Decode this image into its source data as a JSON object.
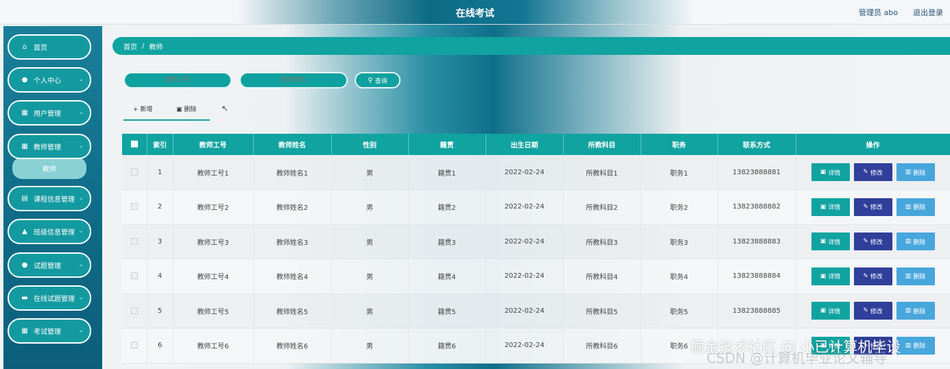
{
  "header": {
    "title": "在线考试",
    "admin_label": "管理员 abo",
    "logout_label": "退出登录"
  },
  "sidebar": {
    "items": [
      {
        "label": "首页",
        "icon": "home-icon",
        "glyph": "⌂",
        "has_chevron": false
      },
      {
        "label": "个人中心",
        "icon": "user-icon",
        "glyph": "●",
        "has_chevron": true
      },
      {
        "label": "用户管理",
        "icon": "grid-icon",
        "glyph": "▦",
        "has_chevron": true
      },
      {
        "label": "教师管理",
        "icon": "grid-icon",
        "glyph": "▦",
        "has_chevron": true
      },
      {
        "label": "课程信息管理",
        "icon": "document-icon",
        "glyph": "▤",
        "has_chevron": true
      },
      {
        "label": "班级信息管理",
        "icon": "thumbs-up-icon",
        "glyph": "▲",
        "has_chevron": true
      },
      {
        "label": "试题管理",
        "icon": "bulb-icon",
        "glyph": "●",
        "has_chevron": true
      },
      {
        "label": "在线试题管理",
        "icon": "card-icon",
        "glyph": "▬",
        "has_chevron": true
      },
      {
        "label": "考试管理",
        "icon": "grid-icon",
        "glyph": "▦",
        "has_chevron": true
      }
    ],
    "submenu_active": "教师"
  },
  "breadcrumb": {
    "home": "首页",
    "separator": "/",
    "current": "教师"
  },
  "search": {
    "teacher_id_placeholder": "教师工号",
    "teacher_name_placeholder": "教师姓名",
    "button_label": "查询"
  },
  "actions": {
    "add_label": "新增",
    "delete_label": "删除"
  },
  "table": {
    "columns": [
      "索引",
      "教师工号",
      "教师姓名",
      "性别",
      "籍贯",
      "出生日期",
      "所教科目",
      "职务",
      "联系方式",
      "操作"
    ],
    "rows": [
      {
        "index": "1",
        "teacher_id": "教师工号1",
        "name": "教师姓名1",
        "gender": "男",
        "hometown": "籍贯1",
        "birth": "2022-02-24",
        "subject": "所教科目1",
        "position": "职务1",
        "phone": "13823888881"
      },
      {
        "index": "2",
        "teacher_id": "教师工号2",
        "name": "教师姓名2",
        "gender": "男",
        "hometown": "籍贯2",
        "birth": "2022-02-24",
        "subject": "所教科目2",
        "position": "职务2",
        "phone": "13823888882"
      },
      {
        "index": "3",
        "teacher_id": "教师工号3",
        "name": "教师姓名3",
        "gender": "男",
        "hometown": "籍贯3",
        "birth": "2022-02-24",
        "subject": "所教科目3",
        "position": "职务3",
        "phone": "13823888883"
      },
      {
        "index": "4",
        "teacher_id": "教师工号4",
        "name": "教师姓名4",
        "gender": "男",
        "hometown": "籍贯4",
        "birth": "2022-02-24",
        "subject": "所教科目4",
        "position": "职务4",
        "phone": "13823888884"
      },
      {
        "index": "5",
        "teacher_id": "教师工号5",
        "name": "教师姓名5",
        "gender": "男",
        "hometown": "籍贯5",
        "birth": "2022-02-24",
        "subject": "所教科目5",
        "position": "职务5",
        "phone": "13823888885"
      },
      {
        "index": "6",
        "teacher_id": "教师工号6",
        "name": "教师姓名6",
        "gender": "男",
        "hometown": "籍贯6",
        "birth": "2022-02-24",
        "subject": "所教科目6",
        "position": "职务6",
        "phone": ""
      }
    ],
    "op_labels": {
      "detail": "详情",
      "edit": "修改",
      "delete": "删除"
    }
  },
  "watermark": {
    "line1": "掘金技术社区 @ 小已计算机毕设",
    "line2": "CSDN @计算机毕业论文辅导"
  },
  "colors": {
    "accent": "#10a3a0",
    "edit": "#2f3f9a",
    "delete": "#47a6dc",
    "sidebar": "#0f6a86"
  }
}
